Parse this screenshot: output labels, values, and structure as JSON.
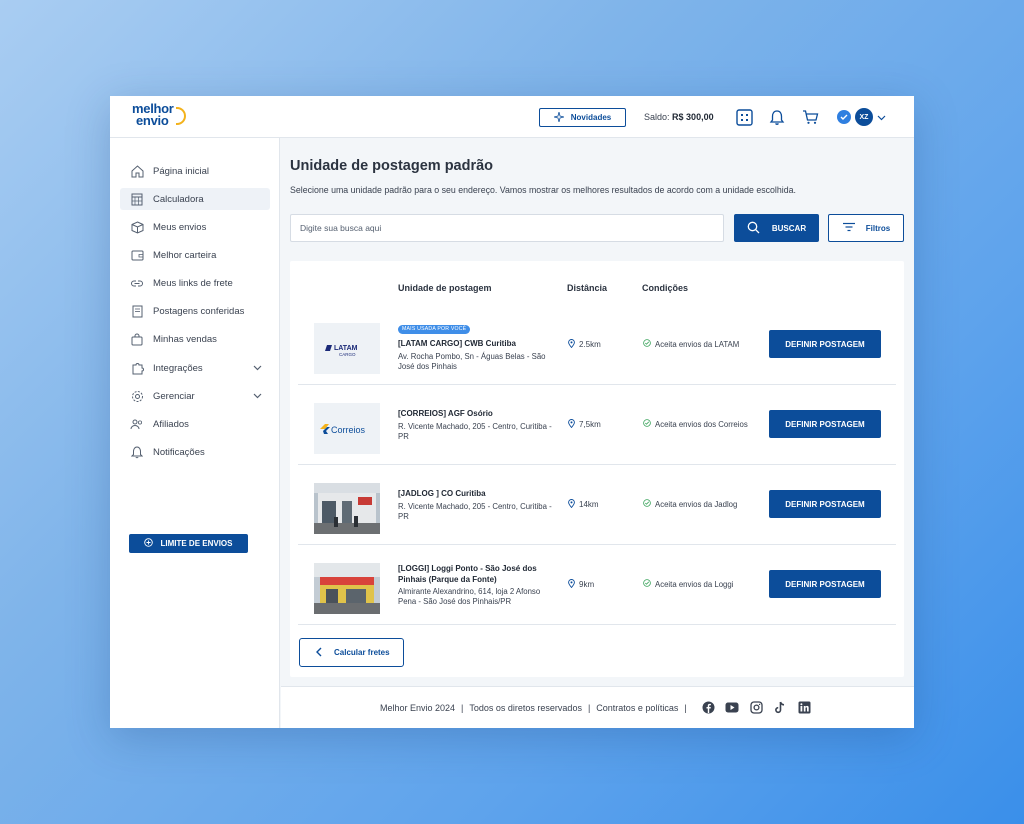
{
  "brand": {
    "logo_line1": "melhor",
    "logo_line2": "envio"
  },
  "header": {
    "news_label": "Novidades",
    "balance_label": "Saldo:",
    "balance_value": "R$ 300,00",
    "user_initials": "XZ"
  },
  "sidebar": {
    "items": [
      {
        "label": "Página inicial",
        "icon": "home-icon"
      },
      {
        "label": "Calculadora",
        "icon": "calculator-icon",
        "active": true
      },
      {
        "label": "Meus envios",
        "icon": "box-icon"
      },
      {
        "label": "Melhor carteira",
        "icon": "wallet-icon"
      },
      {
        "label": "Meus links de frete",
        "icon": "link-icon"
      },
      {
        "label": "Postagens conferidas",
        "icon": "receipt-icon"
      },
      {
        "label": "Minhas vendas",
        "icon": "bag-icon"
      },
      {
        "label": "Integrações",
        "icon": "puzzle-icon",
        "expandable": true
      },
      {
        "label": "Gerenciar",
        "icon": "gear-icon",
        "expandable": true
      },
      {
        "label": "Afiliados",
        "icon": "users-icon"
      },
      {
        "label": "Notificações",
        "icon": "bell-icon"
      }
    ],
    "limit_button": "LIMITE DE ENVIOS"
  },
  "main": {
    "title": "Unidade de postagem padrão",
    "description": "Selecione uma unidade padrão para o seu endereço. Vamos mostrar os melhores resultados de acordo com a unidade escolhida.",
    "search_placeholder": "Digite sua busca aqui",
    "search_button": "BUSCAR",
    "filters_button": "Filtros",
    "table": {
      "headers": [
        "Unidade de postagem",
        "Distância",
        "Condições"
      ],
      "rows": [
        {
          "badge": "MAIS USADA POR VOCÊ",
          "logo_text": "LATAM",
          "logo_sub": "CARGO",
          "name": "[LATAM CARGO] CWB Curitiba",
          "address": "Av. Rocha Pombo, Sn - Águas Belas - São José dos Pinhais",
          "distance": "2.5km",
          "condition": "Aceita envios da LATAM",
          "button": "DEFINIR POSTAGEM"
        },
        {
          "logo_text": "Correios",
          "name": "[CORREIOS] AGF Osório",
          "address": "R. Vicente Machado, 205 - Centro, Curitiba - PR",
          "distance": "7,5km",
          "condition": "Aceita envios dos Correios",
          "button": "DEFINIR POSTAGEM"
        },
        {
          "name": "[JADLOG ] CO Curitiba",
          "address": "R. Vicente Machado, 205 - Centro, Curitiba - PR",
          "distance": "14km",
          "condition": "Aceita envios da Jadlog",
          "button": "DEFINIR POSTAGEM"
        },
        {
          "name": "[LOGGI] Loggi Ponto - São José dos Pinhais (Parque da Fonte)",
          "address": "Almirante Alexandrino, 614, loja 2 Afonso Pena - São José dos Pinhais/PR",
          "distance": "9km",
          "condition": "Aceita envios da Loggi",
          "button": "DEFINIR POSTAGEM"
        }
      ]
    },
    "back_button": "Calcular fretes"
  },
  "footer": {
    "copyright": "Melhor Envio 2024",
    "rights": "Todos os diretos reservados",
    "policies": "Contratos e políticas",
    "social": [
      "facebook-icon",
      "youtube-icon",
      "instagram-icon",
      "tiktok-icon",
      "linkedin-icon"
    ]
  },
  "colors": {
    "primary": "#0c4d9a",
    "badge": "#3f8ee8",
    "accent": "#f3b21b",
    "success": "#3aa35b"
  }
}
